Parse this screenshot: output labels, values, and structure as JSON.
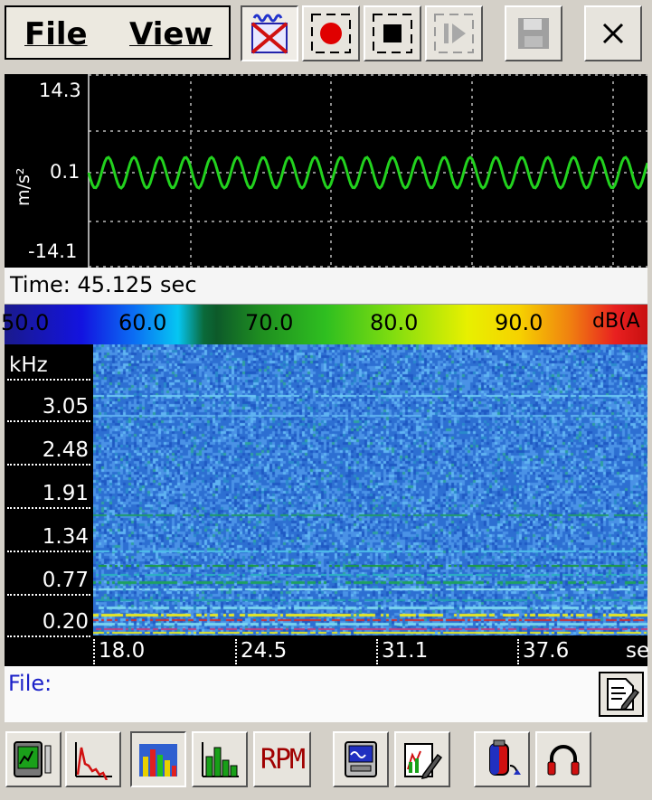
{
  "menu": {
    "file_label": "File",
    "view_label": "View"
  },
  "toolbar": {
    "buttons": [
      {
        "icon": "signal-off-icon",
        "pressed": true
      },
      {
        "icon": "record-icon"
      },
      {
        "icon": "stop-icon"
      },
      {
        "icon": "play-step-icon",
        "disabled": true
      },
      {
        "icon": "save-icon",
        "disabled": true
      },
      {
        "icon": "close-icon"
      }
    ]
  },
  "scope": {
    "y_max": "14.3",
    "y_mid": "0.1",
    "y_min": "-14.1",
    "unit": "m/s²",
    "trace_color": "#22d21e"
  },
  "status": {
    "time_text": "Time: 45.125 sec"
  },
  "color_scale": {
    "labels": [
      "50.0",
      "60.0",
      "70.0",
      "80.0",
      "90.0"
    ],
    "unit": "dB(A"
  },
  "spectrogram": {
    "y_unit": "kHz",
    "y_ticks": [
      "3.05",
      "2.48",
      "1.91",
      "1.34",
      "0.77",
      "0.20"
    ],
    "x_ticks": [
      "18.0",
      "24.5",
      "31.1",
      "37.6"
    ],
    "x_unit": "se"
  },
  "file_row": {
    "label": "File:"
  },
  "bottom_toolbar": {
    "rpm_label": "RPM",
    "buttons": [
      "device-meter-icon",
      "spectrum-line-icon",
      "spectrogram-icon",
      "bar-graph-icon",
      "rpm-icon",
      "monitor-icon",
      "chart-edit-icon",
      "accelerometer-icon",
      "headphones-icon"
    ]
  }
}
